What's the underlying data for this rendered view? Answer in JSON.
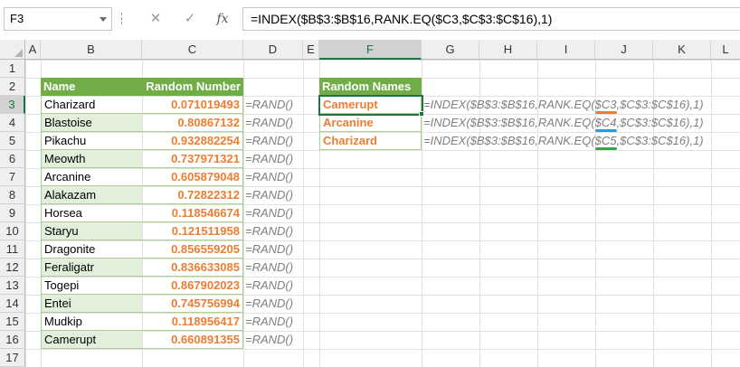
{
  "formula_bar": {
    "name_box": "F3",
    "cancel_icon": "✕",
    "enter_icon": "✓",
    "fx_label": "fx",
    "formula": "=INDEX($B$3:$B$16,RANK.EQ($C3,$C$3:$C$16),1)"
  },
  "columns": [
    "A",
    "B",
    "C",
    "D",
    "E",
    "F",
    "G",
    "H",
    "I",
    "J",
    "K",
    "L"
  ],
  "rows": [
    "1",
    "2",
    "3",
    "4",
    "5",
    "6",
    "7",
    "8",
    "9",
    "10",
    "11",
    "12",
    "13",
    "14",
    "15",
    "16",
    "17"
  ],
  "table1": {
    "header_name": "Name",
    "header_random": "Random Number",
    "rows": [
      {
        "name": "Charizard",
        "value": "0.071019493",
        "formula": "=RAND()"
      },
      {
        "name": "Blastoise",
        "value": "0.80867132",
        "formula": "=RAND()"
      },
      {
        "name": "Pikachu",
        "value": "0.932882254",
        "formula": "=RAND()"
      },
      {
        "name": "Meowth",
        "value": "0.737971321",
        "formula": "=RAND()"
      },
      {
        "name": "Arcanine",
        "value": "0.605879048",
        "formula": "=RAND()"
      },
      {
        "name": "Alakazam",
        "value": "0.72822312",
        "formula": "=RAND()"
      },
      {
        "name": "Horsea",
        "value": "0.118546674",
        "formula": "=RAND()"
      },
      {
        "name": "Staryu",
        "value": "0.121511958",
        "formula": "=RAND()"
      },
      {
        "name": "Dragonite",
        "value": "0.856559205",
        "formula": "=RAND()"
      },
      {
        "name": "Feraligatr",
        "value": "0.836633085",
        "formula": "=RAND()"
      },
      {
        "name": "Togepi",
        "value": "0.867902023",
        "formula": "=RAND()"
      },
      {
        "name": "Entei",
        "value": "0.745756994",
        "formula": "=RAND()"
      },
      {
        "name": "Mudkip",
        "value": "0.118956417",
        "formula": "=RAND()"
      },
      {
        "name": "Camerupt",
        "value": "0.660891355",
        "formula": "=RAND()"
      }
    ]
  },
  "table2": {
    "header": "Random Names",
    "rows": [
      {
        "name": "Camerupt",
        "f_pre": "=INDEX($B$3:$B$16,RANK.EQ(",
        "f_ref": "$C3",
        "f_post": ",$C$3:$C$16),1)"
      },
      {
        "name": "Arcanine",
        "f_pre": "=INDEX($B$3:$B$16,RANK.EQ(",
        "f_ref": "$C4",
        "f_post": ",$C$3:$C$16),1)"
      },
      {
        "name": "Charizard",
        "f_pre": "=INDEX($B$3:$B$16,RANK.EQ(",
        "f_ref": "$C5",
        "f_post": ",$C$3:$C$16),1)"
      }
    ]
  },
  "colors": {
    "header_green": "#70ad47",
    "band_green": "#e2efda",
    "number_orange": "#ed7d31",
    "selection_green": "#217346",
    "underline_orange": "#ed7d31",
    "underline_blue": "#2e9bd6",
    "underline_green": "#2ea84a"
  }
}
